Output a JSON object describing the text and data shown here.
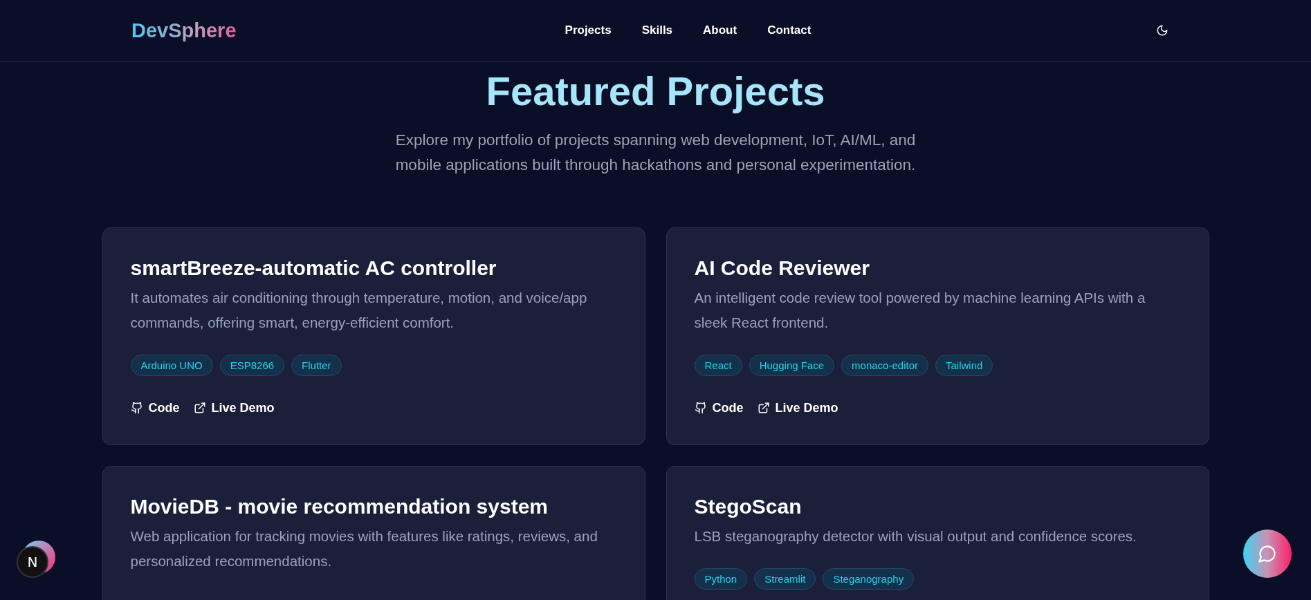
{
  "header": {
    "logo": "DevSphere",
    "nav": [
      "Projects",
      "Skills",
      "About",
      "Contact"
    ]
  },
  "section": {
    "title": "Featured Projects",
    "subtitle": "Explore my portfolio of projects spanning web development, IoT, AI/ML, and mobile applications built through hackathons and personal experimentation."
  },
  "projects": [
    {
      "title": "smartBreeze-automatic AC controller",
      "description": "It automates air conditioning through temperature, motion, and voice/app commands, offering smart, energy-efficient comfort.",
      "tags": [
        "Arduino UNO",
        "ESP8266",
        "Flutter"
      ],
      "links": [
        {
          "kind": "code",
          "label": "Code"
        },
        {
          "kind": "demo",
          "label": "Live Demo"
        }
      ]
    },
    {
      "title": "AI Code Reviewer",
      "description": "An intelligent code review tool powered by machine learning APIs with a sleek React frontend.",
      "tags": [
        "React",
        "Hugging Face",
        "monaco-editor",
        "Tailwind"
      ],
      "links": [
        {
          "kind": "code",
          "label": "Code"
        },
        {
          "kind": "demo",
          "label": "Live Demo"
        }
      ]
    },
    {
      "title": "MovieDB - movie recommendation system",
      "description": "Web application for tracking movies with features like ratings, reviews, and personalized recommendations."
    },
    {
      "title": "StegoScan",
      "description": "LSB steganography detector with visual output and confidence scores.",
      "tags": [
        "Python",
        "Streamlit",
        "Steganography"
      ]
    }
  ],
  "floating": {
    "badge": "N"
  }
}
